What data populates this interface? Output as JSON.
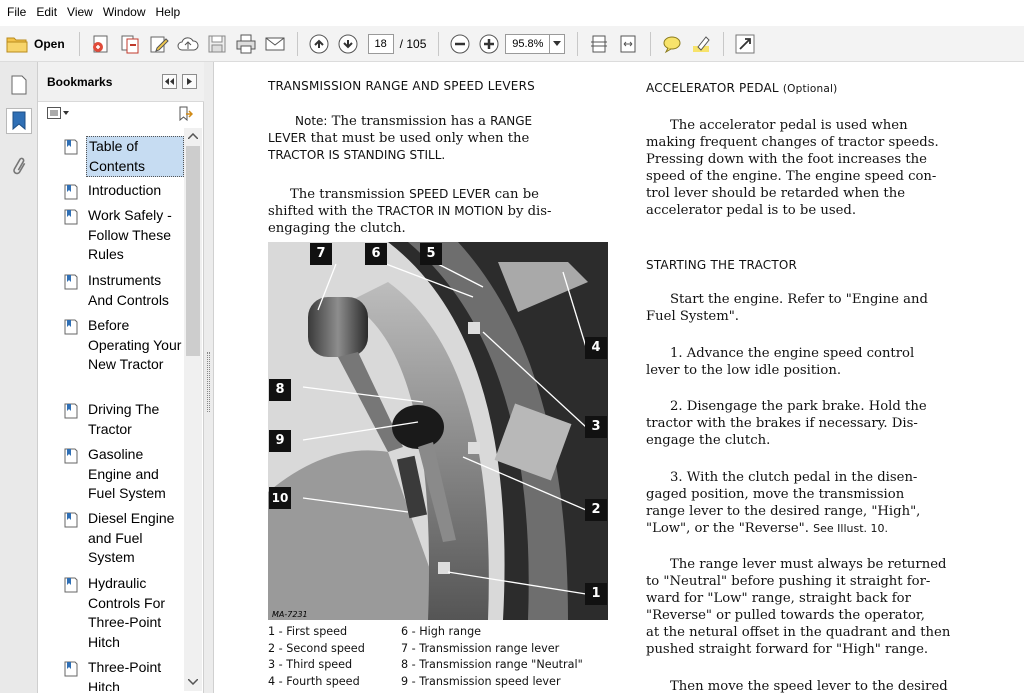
{
  "menu": [
    "File",
    "Edit",
    "View",
    "Window",
    "Help"
  ],
  "toolbar": {
    "open_label": "Open",
    "page_current": "18",
    "page_total": "/ 105",
    "zoom": "95.8%"
  },
  "bookmarks": {
    "title": "Bookmarks",
    "items": [
      "Table of Contents",
      "Introduction",
      "Work Safely - Follow These Rules",
      "Instruments And Controls",
      "Before Operating Your New Tractor",
      "Driving The Tractor",
      "Gasoline Engine and Fuel System",
      "Diesel Engine and Fuel System",
      "Hydraulic Controls For Three-Point Hitch",
      "Three-Point Hitch"
    ],
    "selected_index": 0
  },
  "doc": {
    "left": {
      "heading": "TRANSMISSION RANGE AND SPEED LEVERS",
      "note_label": "Note:",
      "note_p1": "The transmission has a",
      "note_range": "RANGE",
      "note_lever": "LEVER",
      "note_p2": "that must be used only when the",
      "note_tractor": "TRACTOR IS STANDING STILL.",
      "p2_a": "The transmission",
      "p2_speed": "SPEED LEVER",
      "p2_b": "can be",
      "p2_c": "shifted with the",
      "p2_motion": "TRACTOR IN MOTION",
      "p2_d": "by dis-",
      "p2_e": "engaging the clutch.",
      "callouts": [
        "7",
        "6",
        "5",
        "4",
        "3",
        "2",
        "1",
        "8",
        "9",
        "10"
      ],
      "photo_code": "MA-7231",
      "captions_left": [
        "1 - First speed",
        "2 - Second speed",
        "3 - Third speed",
        "4 - Fourth speed"
      ],
      "captions_right": [
        "6 - High range",
        "7 - Transmission range lever",
        "8 - Transmission range \"Neutral\"",
        "9 - Transmission speed lever"
      ]
    },
    "right": {
      "heading1": "ACCELERATOR PEDAL",
      "heading1_opt": "(Optional)",
      "p1": [
        "The accelerator pedal is used when",
        "making frequent changes of tractor speeds.",
        "Pressing down with the foot increases the",
        "speed of the engine. The engine speed con-",
        "trol lever should be retarded when the",
        "accelerator pedal is to be used."
      ],
      "heading2": "STARTING THE TRACTOR",
      "p2": [
        "Start the engine. Refer to \"Engine and",
        "Fuel System\"."
      ],
      "p3": [
        "1. Advance the engine speed control",
        "lever to the low idle position."
      ],
      "p4": [
        "2. Disengage the park brake. Hold the",
        "tractor with the brakes if necessary. Dis-",
        "engage the clutch."
      ],
      "p5": [
        "3. With the clutch pedal in the disen-",
        "gaged position, move the transmission",
        "range lever to the desired range, \"High\",",
        "\"Low\", or the \"Reverse\"."
      ],
      "p5_illus": "See Illust. 10.",
      "p6": [
        "The range lever must always be returned",
        "to \"Neutral\" before pushing it straight for-",
        "ward for \"Low\" range, straight back for",
        "\"Reverse\" or pulled towards the operator,",
        "at the netural offset in the quadrant and then",
        "pushed straight forward for \"High\" range."
      ],
      "p7": "Then move the speed lever to the desired"
    }
  }
}
